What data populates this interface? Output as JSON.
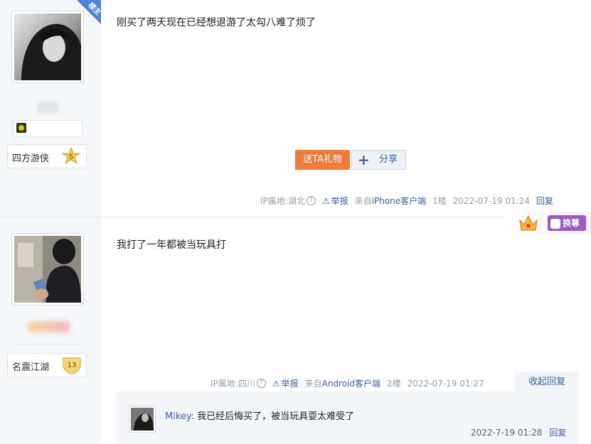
{
  "floor1": {
    "corner_badge": "楼主",
    "badge_name": "四方游侠",
    "badge_level": "5",
    "content": "刚买了两天现在已经想退游了太勾八难了烦了",
    "gift_button": "送TA礼物",
    "share_button": "分享",
    "meta": {
      "ip": "IP属地:湖北",
      "report": "举报",
      "source_prefix": "来自",
      "source_client": "iPhone客户端",
      "floor": "1楼",
      "time": "2022-07-19 01:24",
      "reply": "回复"
    }
  },
  "floor2": {
    "badge_name": "名震江湖",
    "badge_level": "13",
    "swap_button": "换尊",
    "content": "我打了一年都被当玩具打",
    "meta": {
      "ip": "IP属地:四川",
      "report": "举报",
      "source_prefix": "来自",
      "source_client": "Android客户端",
      "floor": "2楼",
      "time": "2022-07-19 01:27",
      "collapse_reply": "收起回复"
    },
    "sub_reply": {
      "user": "Mikey",
      "text": "我已经后悔买了，被当玩具耍太难受了",
      "time": "2022-7-19 01:28",
      "reply": "回复"
    }
  },
  "colors": {
    "link": "#3a65b5",
    "gift": "#f07b3d",
    "swap": "#9b59c9",
    "ribbon": "#4a86d8"
  }
}
